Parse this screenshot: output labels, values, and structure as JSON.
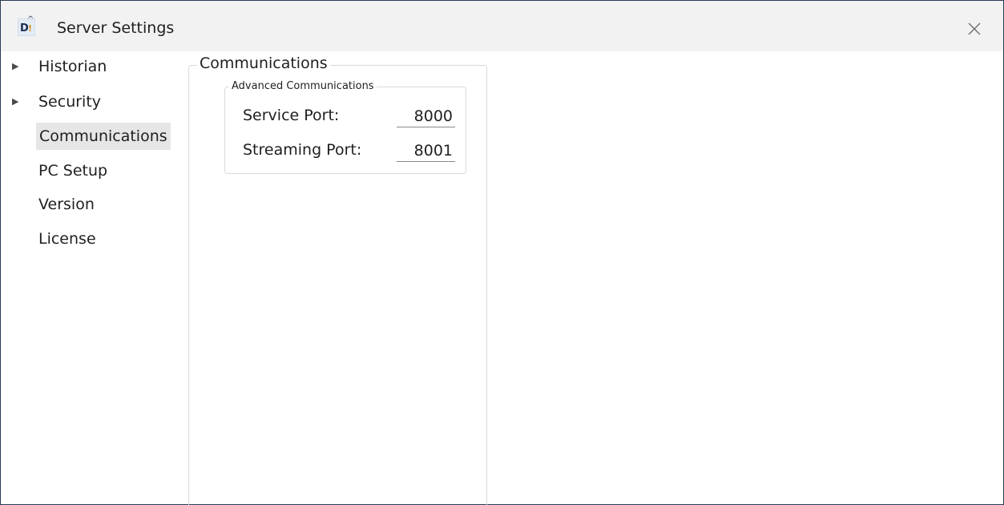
{
  "window": {
    "title": "Server Settings",
    "icon": "app-logo-icon",
    "icon_text_d": "D",
    "icon_text_bang": "!",
    "icon_text_caret": "^",
    "close_icon": "close-icon"
  },
  "nav": {
    "items": [
      {
        "label": "Historian",
        "expandable": true,
        "arrow": "▶"
      },
      {
        "label": "Security",
        "expandable": true,
        "arrow": "▶"
      },
      {
        "label": "Communications",
        "expandable": false,
        "selected": true
      },
      {
        "label": "PC Setup",
        "expandable": false
      },
      {
        "label": "Version",
        "expandable": false
      },
      {
        "label": "License",
        "expandable": false
      }
    ]
  },
  "main": {
    "group_title": "Communications",
    "advanced": {
      "title": "Advanced Communications",
      "service_port_label": "Service Port:",
      "service_port_value": "8000",
      "streaming_port_label": "Streaming Port:",
      "streaming_port_value": "8001"
    }
  },
  "colors": {
    "titlebar_bg": "#f2f2f2",
    "selected_bg": "#e6e6e6",
    "window_border": "#2b3a55",
    "group_border": "#dadada"
  }
}
